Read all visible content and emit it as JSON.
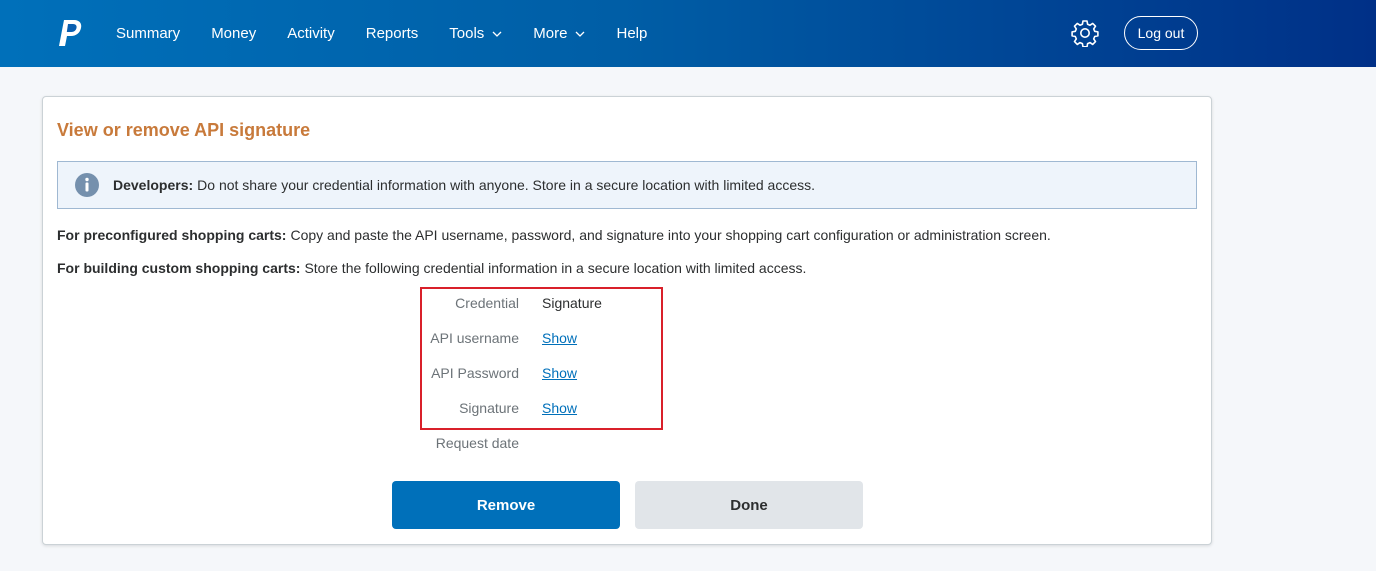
{
  "header": {
    "nav": [
      "Summary",
      "Money",
      "Activity",
      "Reports",
      "Tools",
      "More",
      "Help"
    ],
    "logout_label": "Log out",
    "colors": {
      "brand_start": "#0070ba",
      "brand_end": "#003087"
    }
  },
  "card": {
    "title": "View or remove API signature",
    "info_label": "Developers:",
    "info_text": "Do not share your credential information with anyone. Store in a secure location with limited access.",
    "p1_label": "For preconfigured shopping carts:",
    "p1_text": "Copy and paste the API username, password, and signature into your shopping cart configuration or administration screen.",
    "p2_label": "For building custom shopping carts:",
    "p2_text": "Store the following credential information in a secure location with limited access.",
    "credentials": {
      "credential_label": "Credential",
      "credential_value": "Signature",
      "username_label": "API username",
      "username_link": "Show",
      "password_label": "API Password",
      "password_link": "Show",
      "signature_label": "Signature",
      "signature_link": "Show",
      "request_date_label": "Request date"
    },
    "remove_label": "Remove",
    "done_label": "Done",
    "colors": {
      "title": "#c87a3b",
      "primary": "#0070ba",
      "highlight_box": "#d9202a"
    }
  }
}
